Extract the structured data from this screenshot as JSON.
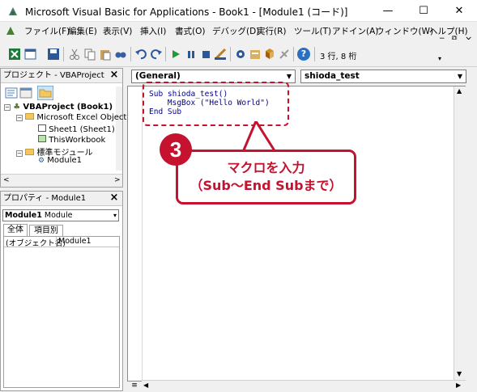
{
  "window": {
    "title": "Microsoft Visual Basic for Applications - Book1 - [Module1 (コード)]",
    "minimize": "—",
    "maximize": "☐",
    "close": "✕"
  },
  "menu": {
    "items": [
      "ファイル(F)",
      "編集(E)",
      "表示(V)",
      "挿入(I)",
      "書式(O)",
      "デバッグ(D)",
      "実行(R)",
      "ツール(T)",
      "アドイン(A)",
      "ウィンドウ(W)",
      "ヘルプ(H)"
    ],
    "mdi_min": "−",
    "mdi_restore": "⧉",
    "mdi_close": "×"
  },
  "toolbar": {
    "position": "3 行, 8 桁",
    "help": "?"
  },
  "project": {
    "title": "プロジェクト - VBAProject",
    "root": "VBAProject (Book1)",
    "folder_excel": "Microsoft Excel Object",
    "sheet1": "Sheet1 (Sheet1)",
    "thisworkbook": "ThisWorkbook",
    "folder_modules": "標準モジュール",
    "module1": "Module1"
  },
  "properties": {
    "title": "プロパティ - Module1",
    "object_name": "Module1",
    "object_type": "Module",
    "tab_all": "全体",
    "tab_category": "項目別",
    "prop_name": "(オブジェクト名)",
    "prop_value": "Module1"
  },
  "code": {
    "object_combo": "(General)",
    "proc_combo": "shioda_test",
    "lines": "Sub shioda_test()\n    MsgBox (\"Hello World\")\nEnd Sub"
  },
  "annotation": {
    "number": "3",
    "line1": "マクロを入力",
    "line2": "（Sub～End Subまで）",
    "color": "#c4122f"
  }
}
